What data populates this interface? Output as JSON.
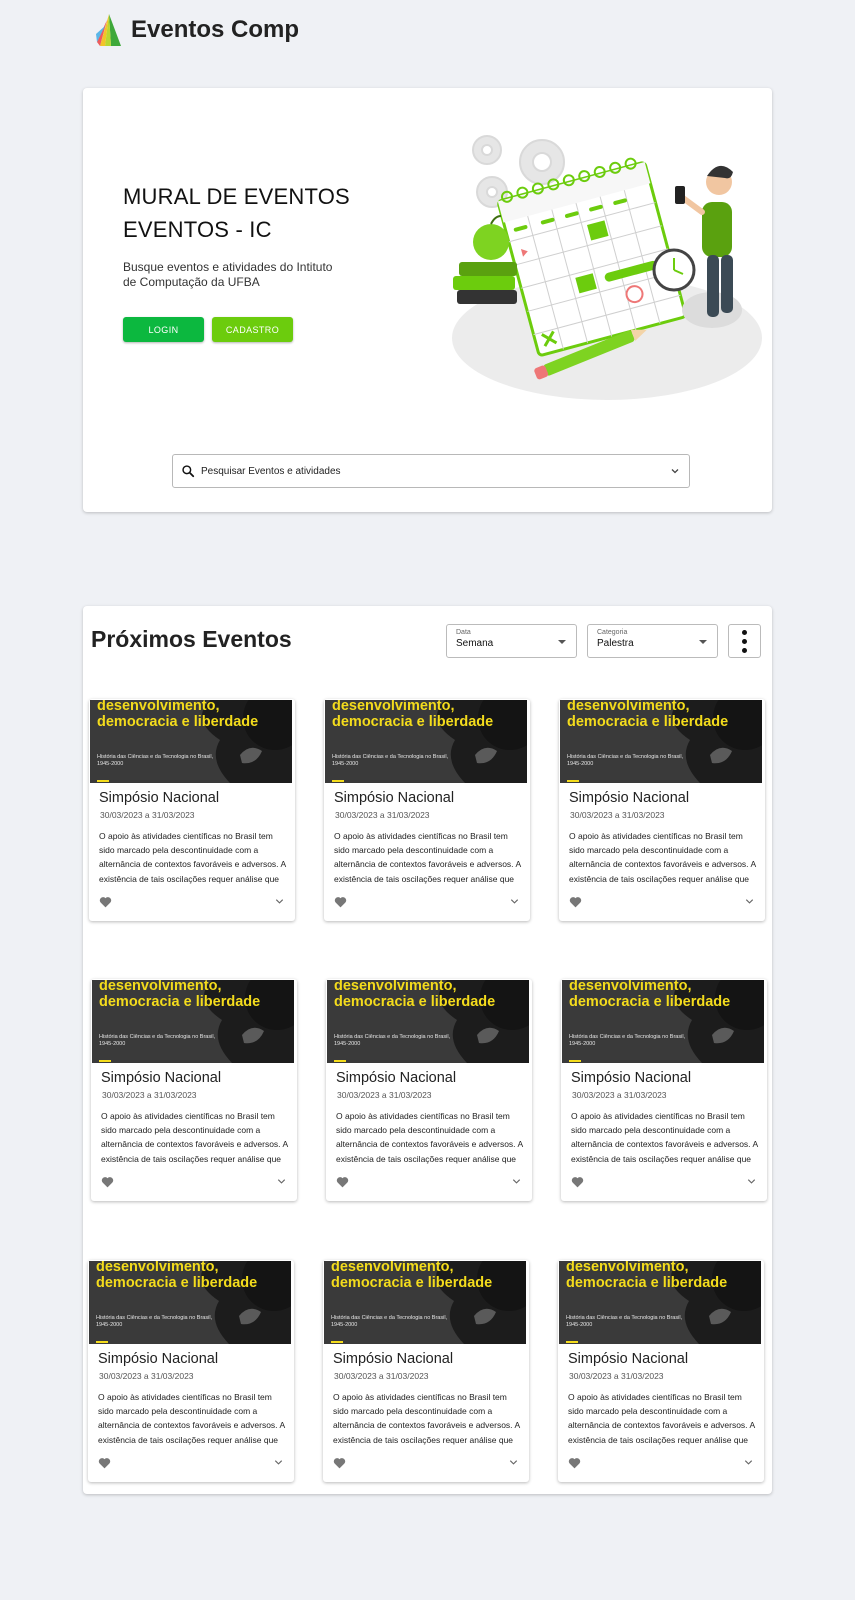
{
  "brand": {
    "title": "Eventos Comp",
    "icon": "rainbow-leaf-logo"
  },
  "hero": {
    "title_line1": "MURAL DE EVENTOS",
    "title_line2": "EVENTOS - IC",
    "subtitle": "Busque eventos e atividades do Intituto de Computação da UFBA",
    "login_label": "LOGIN",
    "cadastro_label": "CADASTRO",
    "illustration": "calendar-planner-illustration",
    "search_placeholder": "Pesquisar Eventos e atividades"
  },
  "colors": {
    "login": "#0cb83f",
    "cadastro": "#6ccc0d",
    "accent_yellow": "#f4dc1c",
    "background": "#eff1f5"
  },
  "events": {
    "title": "Próximos Eventos",
    "filter_date": {
      "label": "Data",
      "value": "Semana"
    },
    "filter_category": {
      "label": "Categoria",
      "value": "Palestra"
    },
    "more_icon": "more-vertical-icon",
    "cards": [
      {
        "image_headline": "desenvolvimento, democracia e liberdade",
        "image_caption": "História das Ciências e da Tecnologia no Brasil, 1945-2000",
        "title": "Simpósio Nacional",
        "date": "30/03/2023 a 31/03/2023",
        "description": "O apoio às atividades científicas no Brasil tem sido marcado pela descontinuidade com a alternância de contextos favoráveis e adversos. A existência de tais oscilações requer análise que"
      },
      {
        "image_headline": "desenvolvimento, democracia e liberdade",
        "image_caption": "História das Ciências e da Tecnologia no Brasil, 1945-2000",
        "title": "Simpósio Nacional",
        "date": "30/03/2023 a 31/03/2023",
        "description": "O apoio às atividades científicas no Brasil tem sido marcado pela descontinuidade com a alternância de contextos favoráveis e adversos. A existência de tais oscilações requer análise que"
      },
      {
        "image_headline": "desenvolvimento, democracia e liberdade",
        "image_caption": "História das Ciências e da Tecnologia no Brasil, 1945-2000",
        "title": "Simpósio Nacional",
        "date": "30/03/2023 a 31/03/2023",
        "description": "O apoio às atividades científicas no Brasil tem sido marcado pela descontinuidade com a alternância de contextos favoráveis e adversos. A existência de tais oscilações requer análise que"
      },
      {
        "image_headline": "desenvolvimento, democracia e liberdade",
        "image_caption": "História das Ciências e da Tecnologia no Brasil, 1945-2000",
        "title": "Simpósio Nacional",
        "date": "30/03/2023 a 31/03/2023",
        "description": "O apoio às atividades científicas no Brasil tem sido marcado pela descontinuidade com a alternância de contextos favoráveis e adversos. A existência de tais oscilações requer análise que"
      },
      {
        "image_headline": "desenvolvimento, democracia e liberdade",
        "image_caption": "História das Ciências e da Tecnologia no Brasil, 1945-2000",
        "title": "Simpósio Nacional",
        "date": "30/03/2023 a 31/03/2023",
        "description": "O apoio às atividades científicas no Brasil tem sido marcado pela descontinuidade com a alternância de contextos favoráveis e adversos. A existência de tais oscilações requer análise que"
      },
      {
        "image_headline": "desenvolvimento, democracia e liberdade",
        "image_caption": "História das Ciências e da Tecnologia no Brasil, 1945-2000",
        "title": "Simpósio Nacional",
        "date": "30/03/2023 a 31/03/2023",
        "description": "O apoio às atividades científicas no Brasil tem sido marcado pela descontinuidade com a alternância de contextos favoráveis e adversos. A existência de tais oscilações requer análise que"
      },
      {
        "image_headline": "desenvolvimento, democracia e liberdade",
        "image_caption": "História das Ciências e da Tecnologia no Brasil, 1945-2000",
        "title": "Simpósio Nacional",
        "date": "30/03/2023 a 31/03/2023",
        "description": "O apoio às atividades científicas no Brasil tem sido marcado pela descontinuidade com a alternância de contextos favoráveis e adversos. A existência de tais oscilações requer análise que"
      },
      {
        "image_headline": "desenvolvimento, democracia e liberdade",
        "image_caption": "História das Ciências e da Tecnologia no Brasil, 1945-2000",
        "title": "Simpósio Nacional",
        "date": "30/03/2023 a 31/03/2023",
        "description": "O apoio às atividades científicas no Brasil tem sido marcado pela descontinuidade com a alternância de contextos favoráveis e adversos. A existência de tais oscilações requer análise que"
      },
      {
        "image_headline": "desenvolvimento, democracia e liberdade",
        "image_caption": "História das Ciências e da Tecnologia no Brasil, 1945-2000",
        "title": "Simpósio Nacional",
        "date": "30/03/2023 a 31/03/2023",
        "description": "O apoio às atividades científicas no Brasil tem sido marcado pela descontinuidade com a alternância de contextos favoráveis e adversos. A existência de tais oscilações requer análise que"
      }
    ]
  }
}
